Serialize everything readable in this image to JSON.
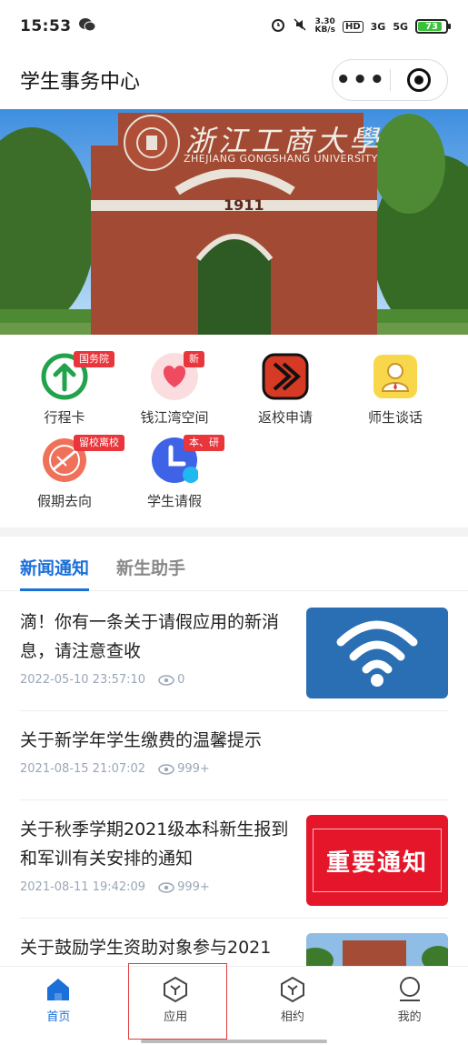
{
  "status_bar": {
    "time": "15:53",
    "net_speed_value": "3.30",
    "net_speed_unit": "KB/s",
    "hd_label": "HD",
    "sig1": "3G",
    "sig2": "5G",
    "battery": "73"
  },
  "header": {
    "title": "学生事务中心"
  },
  "banner": {
    "university_cn": "浙江工商大學",
    "university_en": "ZHEJIANG GONGSHANG UNIVERSITY",
    "gate_year": "1911"
  },
  "apps": [
    {
      "label": "行程卡",
      "badge": "国务院",
      "icon": "up-arrow-circle-icon"
    },
    {
      "label": "钱江湾空间",
      "badge": "新",
      "icon": "heart-icon"
    },
    {
      "label": "返校申请",
      "badge": "",
      "icon": "return-chevron-icon"
    },
    {
      "label": "师生谈话",
      "badge": "",
      "icon": "person-icon"
    },
    {
      "label": "假期去向",
      "badge": "留校离校",
      "icon": "sign-icon"
    },
    {
      "label": "学生请假",
      "badge": "本、研",
      "icon": "clock-icon"
    }
  ],
  "tabs": [
    {
      "label": "新闻通知",
      "active": true
    },
    {
      "label": "新生助手",
      "active": false
    }
  ],
  "news": [
    {
      "title": "滴！你有一条关于请假应用的新消息，请注意查收",
      "date": "2022-05-10 23:57:10",
      "views": "0",
      "thumb": "wifi"
    },
    {
      "title": "关于新学年学生缴费的温馨提示",
      "date": "2021-08-15 21:07:02",
      "views": "999+",
      "thumb": ""
    },
    {
      "title": "关于秋季学期2021级本科新生报到和军训有关安排的通知",
      "date": "2021-08-11 19:42:09",
      "views": "999+",
      "thumb": "important",
      "thumb_text": "重要通知"
    },
    {
      "title": "关于鼓励学生资助对象参与2021",
      "date": "",
      "views": "",
      "thumb": "photo"
    }
  ],
  "bottom_nav": [
    {
      "label": "首页",
      "active": true,
      "icon": "home-icon"
    },
    {
      "label": "应用",
      "active": false,
      "icon": "apps-icon"
    },
    {
      "label": "相约",
      "active": false,
      "icon": "meet-icon"
    },
    {
      "label": "我的",
      "active": false,
      "icon": "profile-icon"
    }
  ],
  "colors": {
    "accent": "#1a6fd8",
    "badge": "#e8363c",
    "important_bg": "#e5162a",
    "wifi_bg": "#2a6fb4"
  }
}
